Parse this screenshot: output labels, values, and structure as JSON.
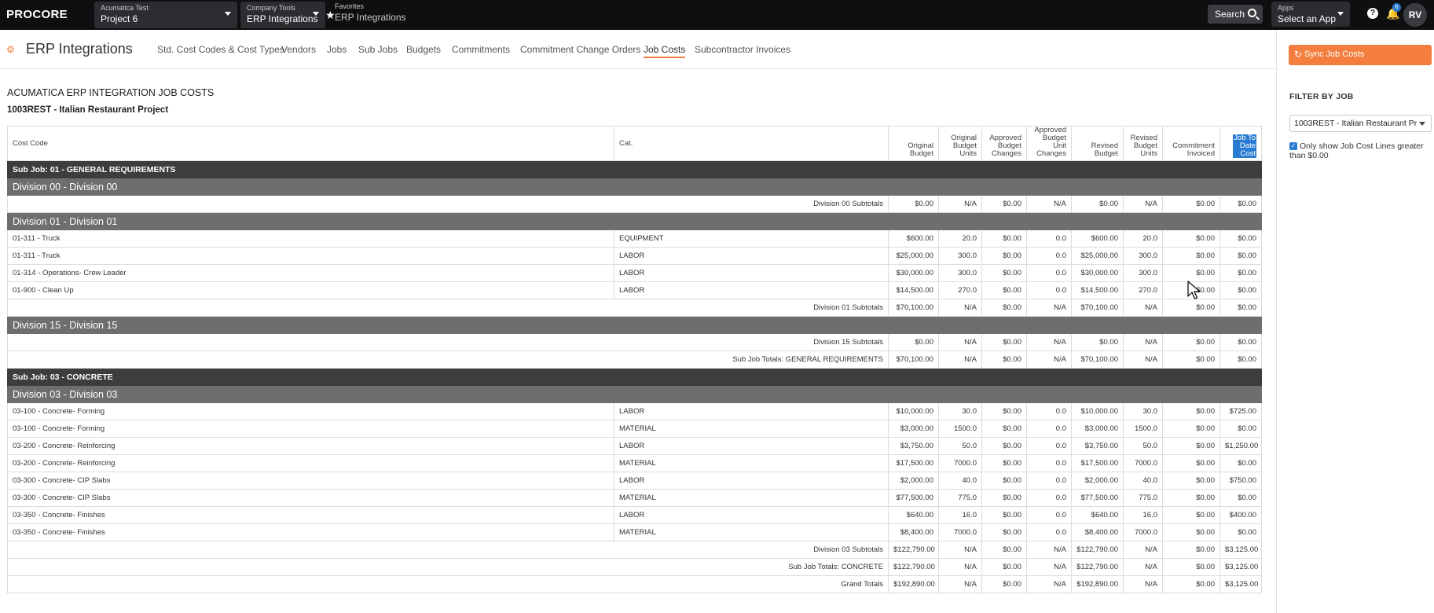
{
  "topbar": {
    "logo": "PROCORE",
    "company_small": "Acumatica Test",
    "company_big": "Project 6",
    "tools_small": "Company Tools",
    "tools_big": "ERP Integrations",
    "fav_small": "Favorites",
    "fav_big": "ERP Integrations",
    "search_label": "Search",
    "apps_small": "Apps",
    "apps_big": "Select an App",
    "help": "?",
    "notifications_count": "6",
    "avatar_initials": "RV"
  },
  "page": {
    "title": "ERP Integrations",
    "tabs": [
      "Std. Cost Codes & Cost Types",
      "Vendors",
      "Jobs",
      "Sub Jobs",
      "Budgets",
      "Commitments",
      "Commitment Change Orders",
      "Job Costs",
      "Subcontractor Invoices"
    ],
    "active_tab": "Job Costs",
    "report_title": "ACUMATICA ERP INTEGRATION JOB COSTS",
    "project_name": "1003REST - Italian Restaurant Project"
  },
  "table": {
    "headers": {
      "cost_code": "Cost Code",
      "cat": "Cat.",
      "original_budget_1": "Original",
      "original_budget_2": "Budget",
      "original_units_1": "Original",
      "original_units_2": "Budget",
      "original_units_3": "Units",
      "approved_changes_1": "Approved",
      "approved_changes_2": "Budget",
      "approved_changes_3": "Changes",
      "approved_unit_1": "Approved",
      "approved_unit_2": "Budget",
      "approved_unit_3": "Unit",
      "approved_unit_4": "Changes",
      "revised_budget_1": "Revised",
      "revised_budget_2": "Budget",
      "revised_units_1": "Revised",
      "revised_units_2": "Budget",
      "revised_units_3": "Units",
      "commitment_1": "Commitment",
      "commitment_2": "Invoiced",
      "jtd_1": "Job To",
      "jtd_2": "Date",
      "jtd_3": "Cost"
    },
    "rows": {
      "sj1": {
        "label": "Sub Job: 01 - GENERAL REQUIREMENTS"
      },
      "d00": {
        "label": "Division 00 - Division 00"
      },
      "d00s": {
        "label": "Division 00 Subtotals",
        "ob": "$0.00",
        "obu": "N/A",
        "abc": "$0.00",
        "abu": "N/A",
        "rb": "$0.00",
        "rbu": "N/A",
        "ci": "$0.00",
        "jtd": "$0.00"
      },
      "d01": {
        "label": "Division 01 - Division 01"
      },
      "r1": {
        "code": "01-311 - Truck",
        "cat": "EQUIPMENT",
        "ob": "$600.00",
        "obu": "20.0",
        "abc": "$0.00",
        "abu": "0.0",
        "rb": "$600.00",
        "rbu": "20.0",
        "ci": "$0.00",
        "jtd": "$0.00"
      },
      "r2": {
        "code": "01-311 - Truck",
        "cat": "LABOR",
        "ob": "$25,000.00",
        "obu": "300.0",
        "abc": "$0.00",
        "abu": "0.0",
        "rb": "$25,000.00",
        "rbu": "300.0",
        "ci": "$0.00",
        "jtd": "$0.00"
      },
      "r3": {
        "code": "01-314 - Operations- Crew Leader",
        "cat": "LABOR",
        "ob": "$30,000.00",
        "obu": "300.0",
        "abc": "$0.00",
        "abu": "0.0",
        "rb": "$30,000.00",
        "rbu": "300.0",
        "ci": "$0.00",
        "jtd": "$0.00"
      },
      "r4": {
        "code": "01-900 - Clean Up",
        "cat": "LABOR",
        "ob": "$14,500.00",
        "obu": "270.0",
        "abc": "$0.00",
        "abu": "0.0",
        "rb": "$14,500.00",
        "rbu": "270.0",
        "ci": "$0.00",
        "jtd": "$0.00"
      },
      "d01s": {
        "label": "Division 01 Subtotals",
        "ob": "$70,100.00",
        "obu": "N/A",
        "abc": "$0.00",
        "abu": "N/A",
        "rb": "$70,100.00",
        "rbu": "N/A",
        "ci": "$0.00",
        "jtd": "$0.00"
      },
      "d15": {
        "label": "Division 15 - Division 15"
      },
      "d15s": {
        "label": "Division 15 Subtotals",
        "ob": "$0.00",
        "obu": "N/A",
        "abc": "$0.00",
        "abu": "N/A",
        "rb": "$0.00",
        "rbu": "N/A",
        "ci": "$0.00",
        "jtd": "$0.00"
      },
      "sj1t": {
        "label": "Sub Job Totals: GENERAL REQUIREMENTS",
        "ob": "$70,100.00",
        "obu": "N/A",
        "abc": "$0.00",
        "abu": "N/A",
        "rb": "$70,100.00",
        "rbu": "N/A",
        "ci": "$0.00",
        "jtd": "$0.00"
      },
      "sj3": {
        "label": "Sub Job: 03 - CONCRETE"
      },
      "d03": {
        "label": "Division 03 - Division 03"
      },
      "c1": {
        "code": "03-100 - Concrete- Forming",
        "cat": "LABOR",
        "ob": "$10,000.00",
        "obu": "30.0",
        "abc": "$0.00",
        "abu": "0.0",
        "rb": "$10,000.00",
        "rbu": "30.0",
        "ci": "$0.00",
        "jtd": "$725.00"
      },
      "c2": {
        "code": "03-100 - Concrete- Forming",
        "cat": "MATERIAL",
        "ob": "$3,000.00",
        "obu": "1500.0",
        "abc": "$0.00",
        "abu": "0.0",
        "rb": "$3,000.00",
        "rbu": "1500.0",
        "ci": "$0.00",
        "jtd": "$0.00"
      },
      "c3": {
        "code": "03-200 - Concrete- Reinforcing",
        "cat": "LABOR",
        "ob": "$3,750.00",
        "obu": "50.0",
        "abc": "$0.00",
        "abu": "0.0",
        "rb": "$3,750.00",
        "rbu": "50.0",
        "ci": "$0.00",
        "jtd": "$1,250.00"
      },
      "c4": {
        "code": "03-200 - Concrete- Reinforcing",
        "cat": "MATERIAL",
        "ob": "$17,500.00",
        "obu": "7000.0",
        "abc": "$0.00",
        "abu": "0.0",
        "rb": "$17,500.00",
        "rbu": "7000.0",
        "ci": "$0.00",
        "jtd": "$0.00"
      },
      "c5": {
        "code": "03-300 - Concrete- CIP Slabs",
        "cat": "LABOR",
        "ob": "$2,000.00",
        "obu": "40.0",
        "abc": "$0.00",
        "abu": "0.0",
        "rb": "$2,000.00",
        "rbu": "40.0",
        "ci": "$0.00",
        "jtd": "$750.00"
      },
      "c6": {
        "code": "03-300 - Concrete- CIP Slabs",
        "cat": "MATERIAL",
        "ob": "$77,500.00",
        "obu": "775.0",
        "abc": "$0.00",
        "abu": "0.0",
        "rb": "$77,500.00",
        "rbu": "775.0",
        "ci": "$0.00",
        "jtd": "$0.00"
      },
      "c7": {
        "code": "03-350 - Concrete- Finishes",
        "cat": "LABOR",
        "ob": "$640.00",
        "obu": "16.0",
        "abc": "$0.00",
        "abu": "0.0",
        "rb": "$640.00",
        "rbu": "16.0",
        "ci": "$0.00",
        "jtd": "$400.00"
      },
      "c8": {
        "code": "03-350 - Concrete- Finishes",
        "cat": "MATERIAL",
        "ob": "$8,400.00",
        "obu": "7000.0",
        "abc": "$0.00",
        "abu": "0.0",
        "rb": "$8,400.00",
        "rbu": "7000.0",
        "ci": "$0.00",
        "jtd": "$0.00"
      },
      "d03s": {
        "label": "Division 03 Subtotals",
        "ob": "$122,790.00",
        "obu": "N/A",
        "abc": "$0.00",
        "abu": "N/A",
        "rb": "$122,790.00",
        "rbu": "N/A",
        "ci": "$0.00",
        "jtd": "$3,125.00"
      },
      "sj3t": {
        "label": "Sub Job Totals: CONCRETE",
        "ob": "$122,790.00",
        "obu": "N/A",
        "abc": "$0.00",
        "abu": "N/A",
        "rb": "$122,790.00",
        "rbu": "N/A",
        "ci": "$0.00",
        "jtd": "$3,125.00"
      },
      "gt": {
        "label": "Grand Totals",
        "ob": "$192,890.00",
        "obu": "N/A",
        "abc": "$0.00",
        "abu": "N/A",
        "rb": "$192,890.00",
        "rbu": "N/A",
        "ci": "$0.00",
        "jtd": "$3,125.00"
      }
    }
  },
  "sidebar": {
    "sync_label": "Sync Job Costs",
    "filter_label": "FILTER BY JOB",
    "filter_value": "1003REST - Italian Restaurant Pr",
    "checkbox_label": "Only show Job Cost Lines greater than $0.00",
    "checkbox_checked": true
  },
  "colors": {
    "accent": "#f47e3e",
    "topbar": "#0e0f10",
    "subjob_band": "#3d3d3d",
    "division_band": "#6e6e6e",
    "selection": "#2a7bd3"
  },
  "icons": [
    "sync-icon",
    "search-icon",
    "gear-icon",
    "star-icon",
    "bell-icon",
    "help-icon",
    "chevron-down-icon",
    "checkbox-icon",
    "cursor-icon"
  ]
}
